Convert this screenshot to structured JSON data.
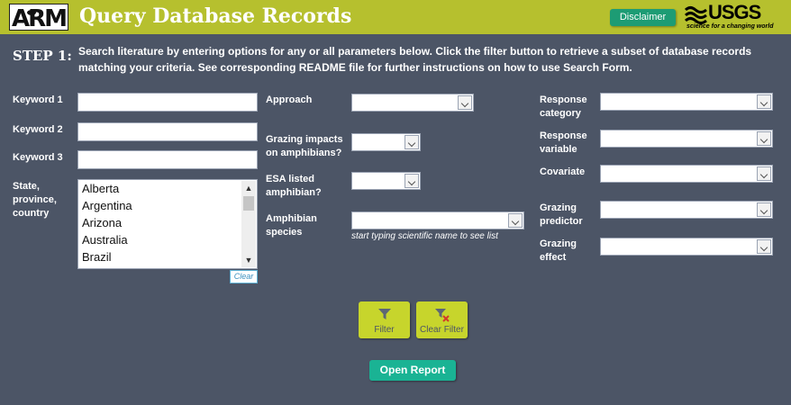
{
  "header": {
    "logo_text": "ARMI",
    "title": "Query Database Records",
    "disclaimer_label": "Disclaimer",
    "usgs_logo": "USGS",
    "usgs_tagline": "science for a changing world",
    "bg_color": "#b6c02e"
  },
  "step": {
    "label": "STEP 1:",
    "text": "Search literature by entering options for any or all parameters below. Click the filter button to retrieve a subset of database records matching your criteria. See corresponding README file for further instructions on how to use Search Form."
  },
  "left": {
    "keyword1_label": "Keyword 1",
    "keyword1_value": "",
    "keyword2_label": "Keyword 2",
    "keyword2_value": "",
    "keyword3_label": "Keyword 3",
    "keyword3_value": "",
    "location_label": "State, province, country",
    "location_items": [
      "Alberta",
      "Argentina",
      "Arizona",
      "Australia",
      "Brazil"
    ],
    "clear_label": "Clear"
  },
  "middle": {
    "approach_label": "Approach",
    "grazing_impacts_label": "Grazing impacts on amphibians?",
    "esa_label": "ESA listed amphibian?",
    "species_label": "Amphibian species",
    "species_hint": "start typing scientific name to see list"
  },
  "right": {
    "response_category_label": "Response category",
    "response_variable_label": "Response variable",
    "covariate_label": "Covariate",
    "grazing_predictor_label": "Grazing predictor",
    "grazing_effect_label": "Grazing effect"
  },
  "buttons": {
    "filter_label": "Filter",
    "clear_filter_label": "Clear Filter",
    "open_report_label": "Open Report"
  },
  "colors": {
    "background": "#4c5566",
    "accent_green": "#c7d52c",
    "teal": "#1ab394"
  }
}
